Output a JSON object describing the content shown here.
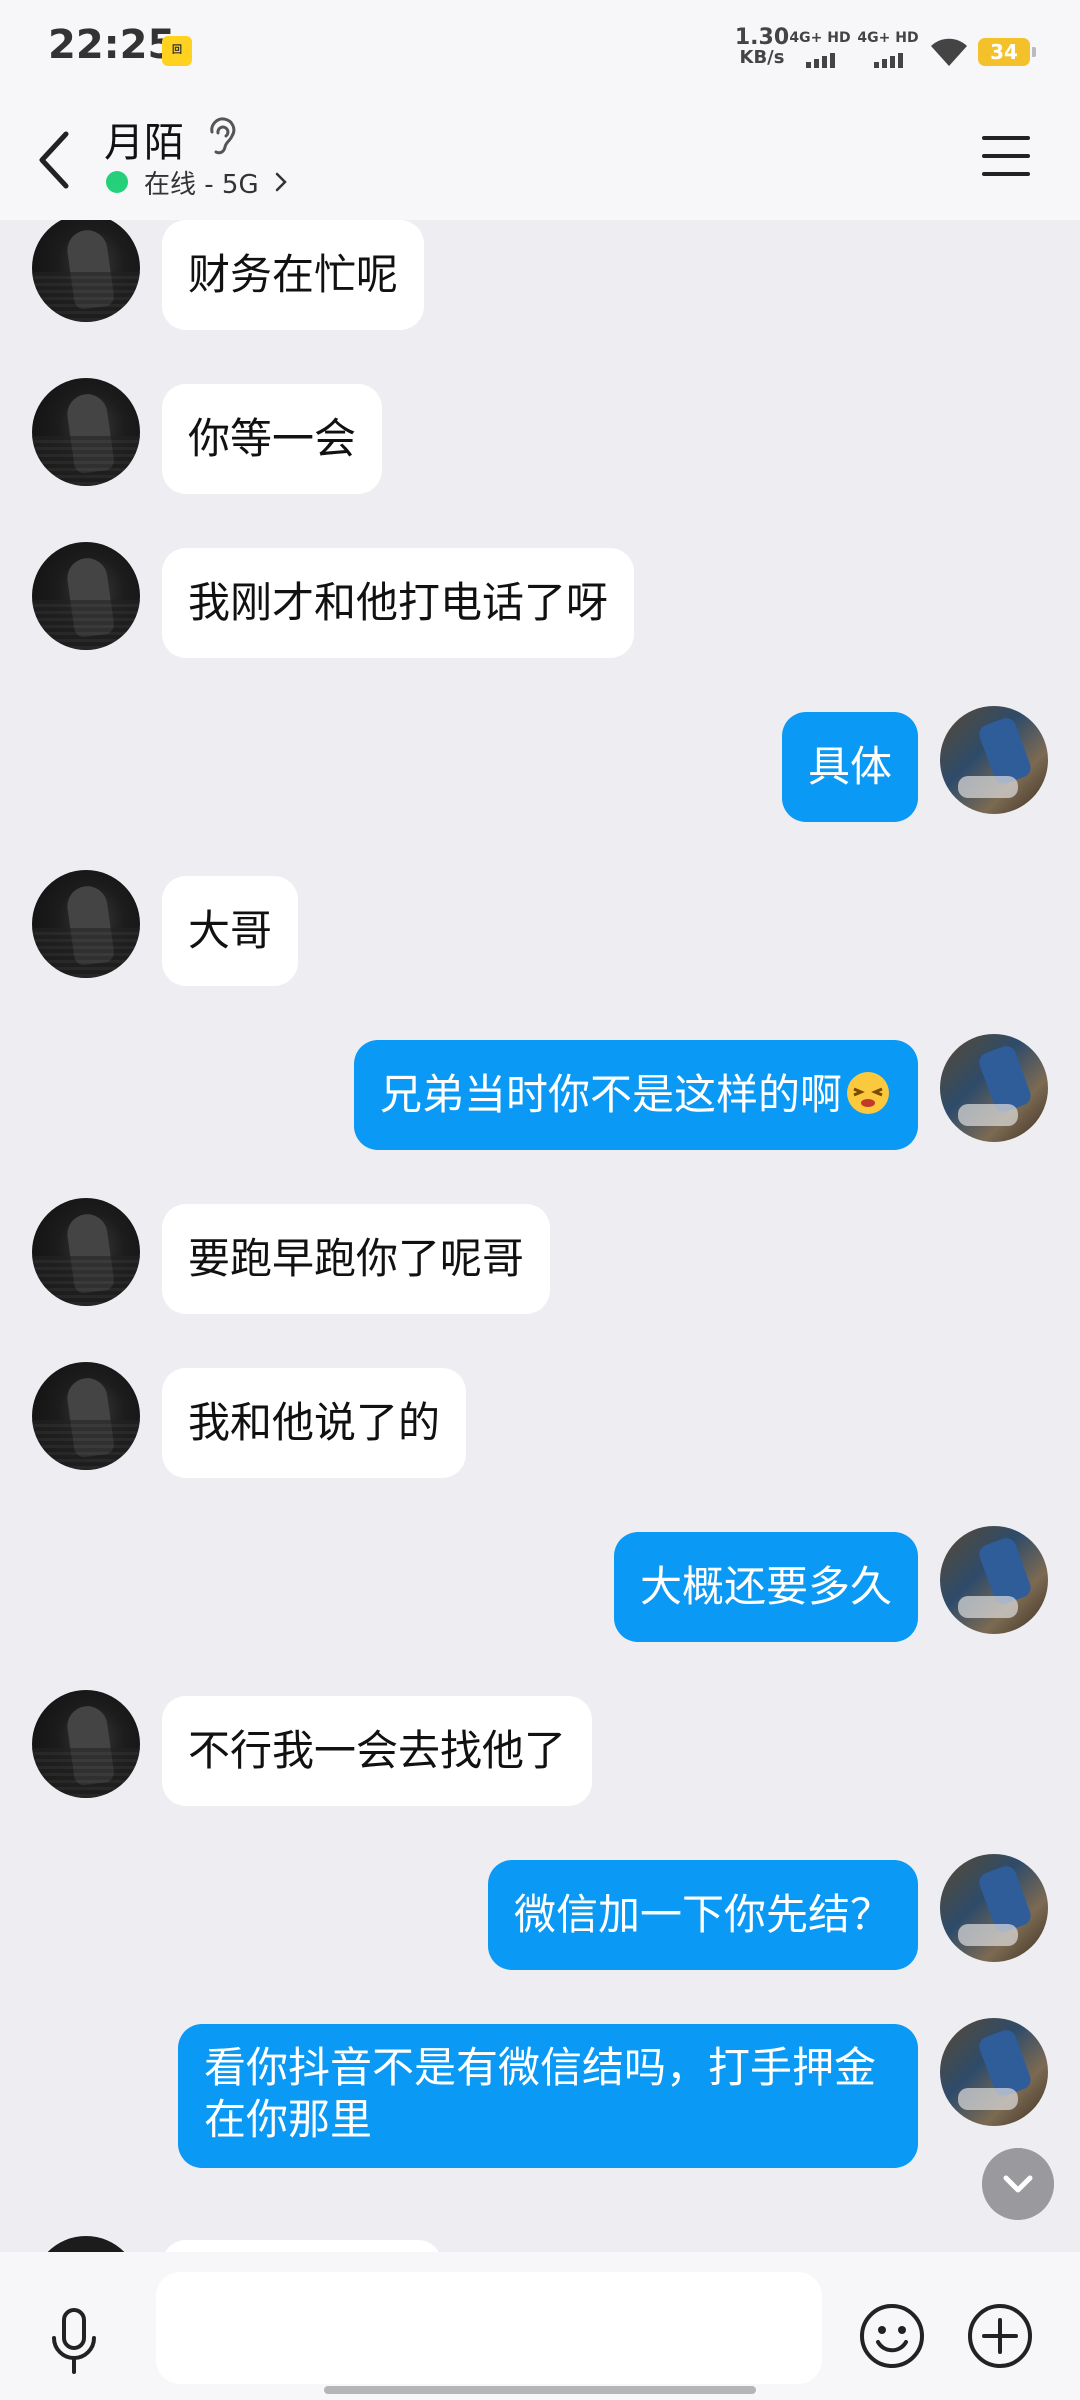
{
  "status_bar": {
    "time": "22:25",
    "app_icon_text": "回",
    "net_speed_value": "1.30",
    "net_speed_unit": "KB/s",
    "signal1_label": "4G+ HD",
    "signal2_label": "4G+ HD",
    "battery": "34"
  },
  "header": {
    "name": "月陌",
    "presence": "在线 - 5G"
  },
  "colors": {
    "sent_bubble": "#0a99f5",
    "received_bubble": "#ffffff",
    "online": "#24d17a",
    "background": "#eeeef2"
  },
  "messages": [
    {
      "side": "left",
      "text": "财务在忙呢"
    },
    {
      "side": "left",
      "text": "你等一会"
    },
    {
      "side": "left",
      "text": "我刚才和他打电话了呀"
    },
    {
      "side": "right",
      "text": "具体"
    },
    {
      "side": "left",
      "text": "大哥"
    },
    {
      "side": "right",
      "text": "兄弟当时你不是这样的啊",
      "emoji": "dizzy-face-emoji"
    },
    {
      "side": "left",
      "text": "要跑早跑你了呢哥"
    },
    {
      "side": "left",
      "text": "我和他说了的"
    },
    {
      "side": "right",
      "text": "大概还要多久"
    },
    {
      "side": "left",
      "text": "不行我一会去找他了"
    },
    {
      "side": "right",
      "text": "微信加一下你先结？"
    },
    {
      "side": "right",
      "text": "看你抖音不是有微信结吗，打手押金在你那里"
    }
  ],
  "input": {
    "placeholder": ""
  }
}
